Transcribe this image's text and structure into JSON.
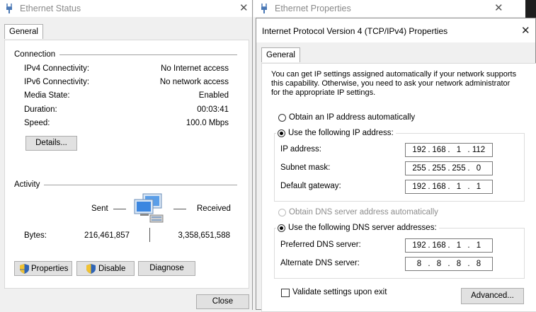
{
  "status_window": {
    "title": "Ethernet Status",
    "tab": "General",
    "connection": {
      "heading": "Connection",
      "rows": [
        {
          "label": "IPv4 Connectivity:",
          "value": "No Internet access"
        },
        {
          "label": "IPv6 Connectivity:",
          "value": "No network access"
        },
        {
          "label": "Media State:",
          "value": "Enabled"
        },
        {
          "label": "Duration:",
          "value": "00:03:41"
        },
        {
          "label": "Speed:",
          "value": "100.0 Mbps"
        }
      ],
      "details_button": "Details..."
    },
    "activity": {
      "heading": "Activity",
      "sent_label": "Sent",
      "received_label": "Received",
      "bytes_label": "Bytes:",
      "bytes_sent": "216,461,857",
      "bytes_received": "3,358,651,588"
    },
    "buttons": {
      "properties": "Properties",
      "disable": "Disable",
      "diagnose": "Diagnose",
      "close": "Close"
    }
  },
  "properties_window": {
    "title": "Ethernet Properties"
  },
  "ipv4_dialog": {
    "title": "Internet Protocol Version 4 (TCP/IPv4) Properties",
    "tab": "General",
    "description": "You can get IP settings assigned automatically if your network supports this capability. Otherwise, you need to ask your network administrator for the appropriate IP settings.",
    "radio_auto_ip": "Obtain an IP address automatically",
    "radio_manual_ip": "Use the following IP address:",
    "ip_address_label": "IP address:",
    "ip_address": [
      "192",
      "168",
      "1",
      "112"
    ],
    "subnet_mask_label": "Subnet mask:",
    "subnet_mask": [
      "255",
      "255",
      "255",
      "0"
    ],
    "gateway_label": "Default gateway:",
    "gateway": [
      "192",
      "168",
      "1",
      "1"
    ],
    "radio_auto_dns": "Obtain DNS server address automatically",
    "radio_manual_dns": "Use the following DNS server addresses:",
    "preferred_dns_label": "Preferred DNS server:",
    "preferred_dns": [
      "192",
      "168",
      "1",
      "1"
    ],
    "alternate_dns_label": "Alternate DNS server:",
    "alternate_dns": [
      "8",
      "8",
      "8",
      "8"
    ],
    "validate_label": "Validate settings upon exit",
    "advanced_button": "Advanced..."
  }
}
